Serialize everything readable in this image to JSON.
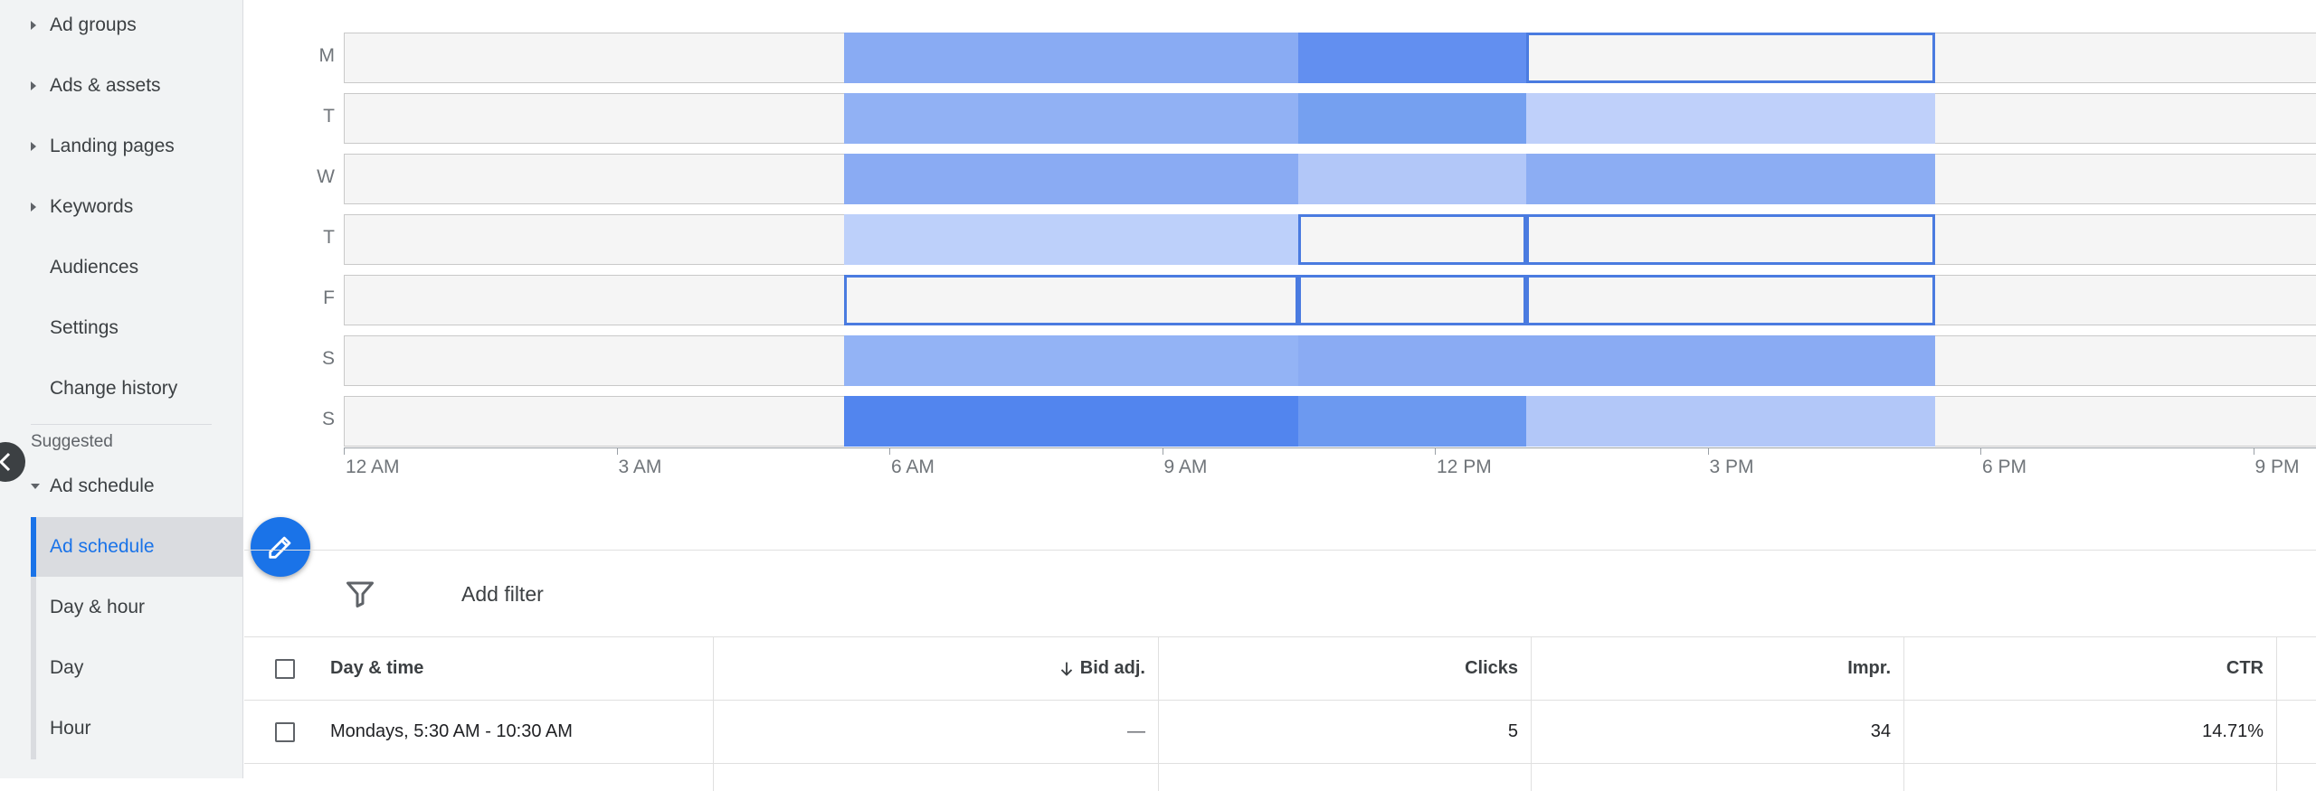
{
  "sidebar": {
    "items": [
      {
        "label": "Ad groups",
        "expandable": true
      },
      {
        "label": "Ads & assets",
        "expandable": true
      },
      {
        "label": "Landing pages",
        "expandable": true
      },
      {
        "label": "Keywords",
        "expandable": true
      },
      {
        "label": "Audiences",
        "expandable": false
      },
      {
        "label": "Settings",
        "expandable": false
      },
      {
        "label": "Change history",
        "expandable": false
      }
    ],
    "suggested_label": "Suggested",
    "group_label": "Ad schedule",
    "sub_items": [
      {
        "label": "Ad schedule",
        "active": true
      },
      {
        "label": "Day & hour",
        "active": false
      },
      {
        "label": "Day",
        "active": false
      },
      {
        "label": "Hour",
        "active": false
      }
    ]
  },
  "heatmap": {
    "days": [
      "M",
      "T",
      "W",
      "T",
      "F",
      "S",
      "S"
    ],
    "time_labels": [
      "12 AM",
      "3 AM",
      "6 AM",
      "9 AM",
      "12 PM",
      "3 PM",
      "6 PM",
      "9 PM"
    ],
    "slots": [
      {
        "start": "5:30 AM",
        "end": "10:30 AM"
      },
      {
        "start": "10:30 AM",
        "end": "1:00 PM"
      },
      {
        "start": "1:00 PM",
        "end": "5:30 PM"
      }
    ],
    "cells": [
      [
        "#89abf3",
        "#628ff0",
        "outline"
      ],
      [
        "#91b1f4",
        "#75a0f0",
        "#bfd0fa"
      ],
      [
        "#8aabf3",
        "#b2c7f8",
        "#8cadf3"
      ],
      [
        "#bdd0fa",
        "outline",
        "outline"
      ],
      [
        "outline",
        "outline",
        "outline"
      ],
      [
        "#93b3f5",
        "#8aabf3",
        "#8aabf3"
      ],
      [
        "#5285ee",
        "#6c99f0",
        "#b2c7f8"
      ]
    ],
    "outline_color": "#4a7be0"
  },
  "filter": {
    "add_filter_label": "Add filter"
  },
  "table": {
    "columns": [
      "Day & time",
      "Bid adj.",
      "Clicks",
      "Impr.",
      "CTR"
    ],
    "rows": [
      {
        "day_time": "Mondays, 5:30 AM - 10:30 AM",
        "bid_adj": "—",
        "clicks": "5",
        "impr": "34",
        "ctr": "14.71%"
      }
    ]
  },
  "colors": {
    "accent": "#1a73e8",
    "sidebar_bg": "#f1f3f4"
  }
}
